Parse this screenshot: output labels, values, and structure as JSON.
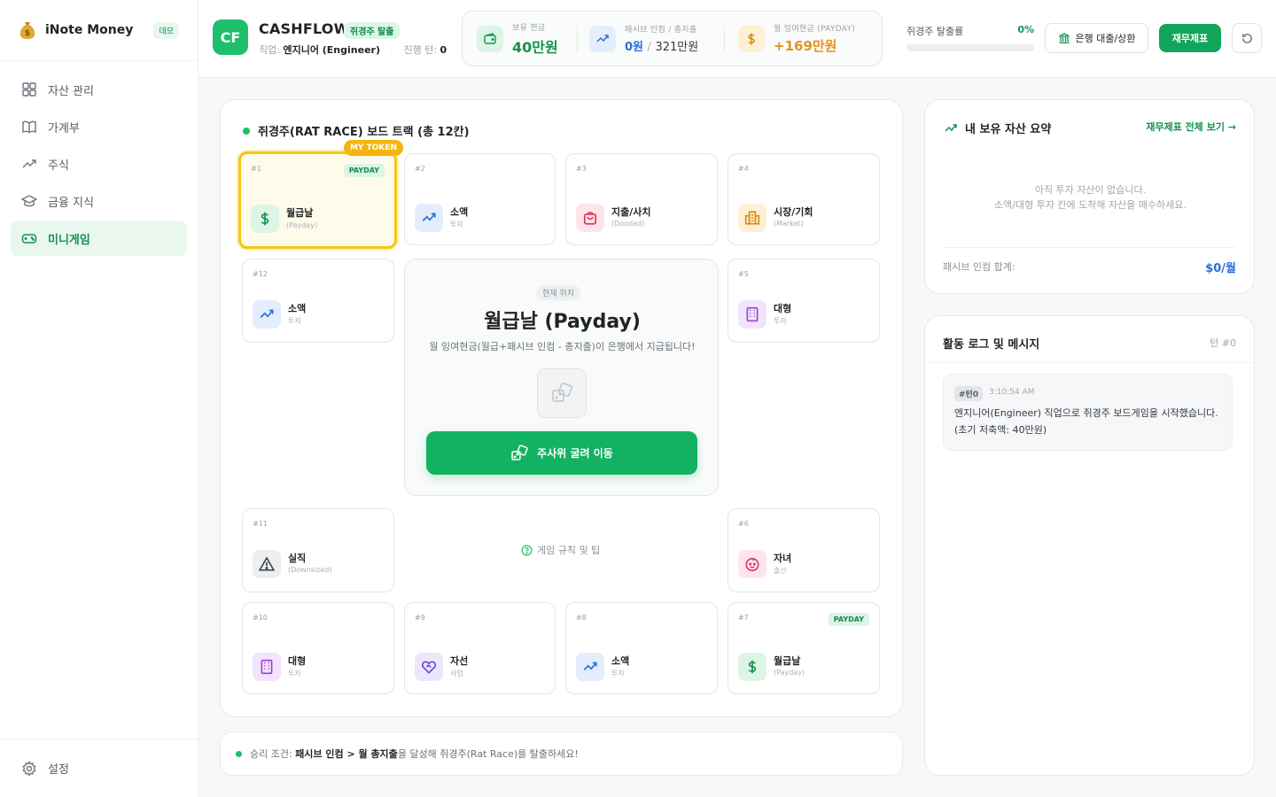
{
  "app": {
    "name": "iNote Money",
    "badge": "데모"
  },
  "sidebar": {
    "items": [
      {
        "label": "자산 관리",
        "icon": "grid-icon"
      },
      {
        "label": "가계부",
        "icon": "book-icon"
      },
      {
        "label": "주식",
        "icon": "trend-up-icon"
      },
      {
        "label": "금융 지식",
        "icon": "graduation-cap-icon"
      },
      {
        "label": "미니게임",
        "icon": "gamepad-icon",
        "active": true
      }
    ],
    "settings_label": "설정"
  },
  "header": {
    "badge": "CF",
    "title": "CASHFLOW",
    "tag": "쥐경주 탈출",
    "job_label": "직업:",
    "job_value": "엔지니어 (Engineer)",
    "turn_label": "진행 턴:",
    "turn_value": "0",
    "stats": {
      "cash": {
        "label": "보유 현금",
        "value": "40만원"
      },
      "passive": {
        "label": "패시브 인컴 / 총지출",
        "income": "0원",
        "sep": "/",
        "expense": "321만원"
      },
      "surplus": {
        "label": "월 잉여현금 (PAYDAY)",
        "value": "+169만원"
      }
    },
    "escape": {
      "label": "쥐경주 탈출률",
      "percent": "0%",
      "progress": 0
    },
    "loan_button": "은행 대출/상환",
    "finance_button": "재무제표"
  },
  "board": {
    "title": "쥐경주(RAT RACE) 보드 트랙 (총 12칸)",
    "my_token": "MY TOKEN",
    "payday_badge": "PAYDAY",
    "cells": {
      "c1": {
        "num": "#1",
        "name": "월급날",
        "sub": "(Payday)"
      },
      "c2": {
        "num": "#2",
        "name": "소액",
        "sub": "투자"
      },
      "c3": {
        "num": "#3",
        "name": "지출/사치",
        "sub": "(Doodad)"
      },
      "c4": {
        "num": "#4",
        "name": "시장/기회",
        "sub": "(Market)"
      },
      "c5": {
        "num": "#5",
        "name": "대형",
        "sub": "투자"
      },
      "c6": {
        "num": "#6",
        "name": "자녀",
        "sub": "출산"
      },
      "c7": {
        "num": "#7",
        "name": "월급날",
        "sub": "(Payday)"
      },
      "c8": {
        "num": "#8",
        "name": "소액",
        "sub": "투자"
      },
      "c9": {
        "num": "#9",
        "name": "자선",
        "sub": "사업"
      },
      "c10": {
        "num": "#10",
        "name": "대형",
        "sub": "투자"
      },
      "c11": {
        "num": "#11",
        "name": "실직",
        "sub": "(Downsized)"
      },
      "c12": {
        "num": "#12",
        "name": "소액",
        "sub": "투자"
      }
    },
    "center": {
      "location_label": "현재 위치",
      "name": "월급날 (Payday)",
      "description": "월 잉여현금(월급+패시브 인컴 - 총지출)이 은행에서 지급됩니다!",
      "roll_button": "주사위 굴려 이동"
    },
    "rules_link": "게임 규칙 및 팁"
  },
  "win_condition": {
    "prefix": "승리 조건:",
    "bold": "패시브 인컴 > 월 총지출",
    "suffix": "을 달성해 쥐경주(Rat Race)를 탈출하세요!"
  },
  "assets": {
    "title": "내 보유 자산 요약",
    "link": "재무제표 전체 보기 →",
    "empty_line1": "아직 투자 자산이 없습니다.",
    "empty_line2": "소액/대형 투자 칸에 도착해 자산을 매수하세요.",
    "passive_label": "패시브 인컴 합계:",
    "passive_value": "$0/월"
  },
  "logs": {
    "title": "활동 로그 및 메시지",
    "turn": "턴 #0",
    "items": [
      {
        "tag": "#턴0",
        "time": "3:10:54 AM",
        "line1": "엔지니어(Engineer) 직업으로 쥐경주 보드게임을 시작했습니다.",
        "line2": "(초기 저축액: 40만원)"
      }
    ]
  },
  "colors": {
    "brand_green": "#13a55c",
    "token_yellow": "#f5b50e",
    "surplus_orange": "#e8901a",
    "passive_blue": "#2b6fd9"
  }
}
